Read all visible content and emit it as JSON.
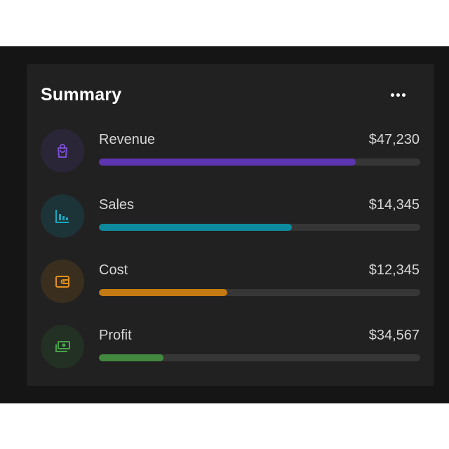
{
  "card": {
    "title": "Summary",
    "menu_icon": "more-horizontal-icon"
  },
  "items": [
    {
      "label": "Revenue",
      "value": "$47,230",
      "icon": "shopping-bag-icon",
      "color": "#5e35b1",
      "bg": "#2b2538",
      "progress": 0.8
    },
    {
      "label": "Sales",
      "value": "$14,345",
      "icon": "bar-chart-icon",
      "color": "#0e8a9e",
      "bg": "#1c3337",
      "progress": 0.6
    },
    {
      "label": "Cost",
      "value": "$12,345",
      "icon": "wallet-icon",
      "color": "#c47a12",
      "bg": "#3a2e1f",
      "progress": 0.4
    },
    {
      "label": "Profit",
      "value": "$34,567",
      "icon": "money-icon",
      "color": "#43883f",
      "bg": "#233024",
      "progress": 0.2
    }
  ]
}
